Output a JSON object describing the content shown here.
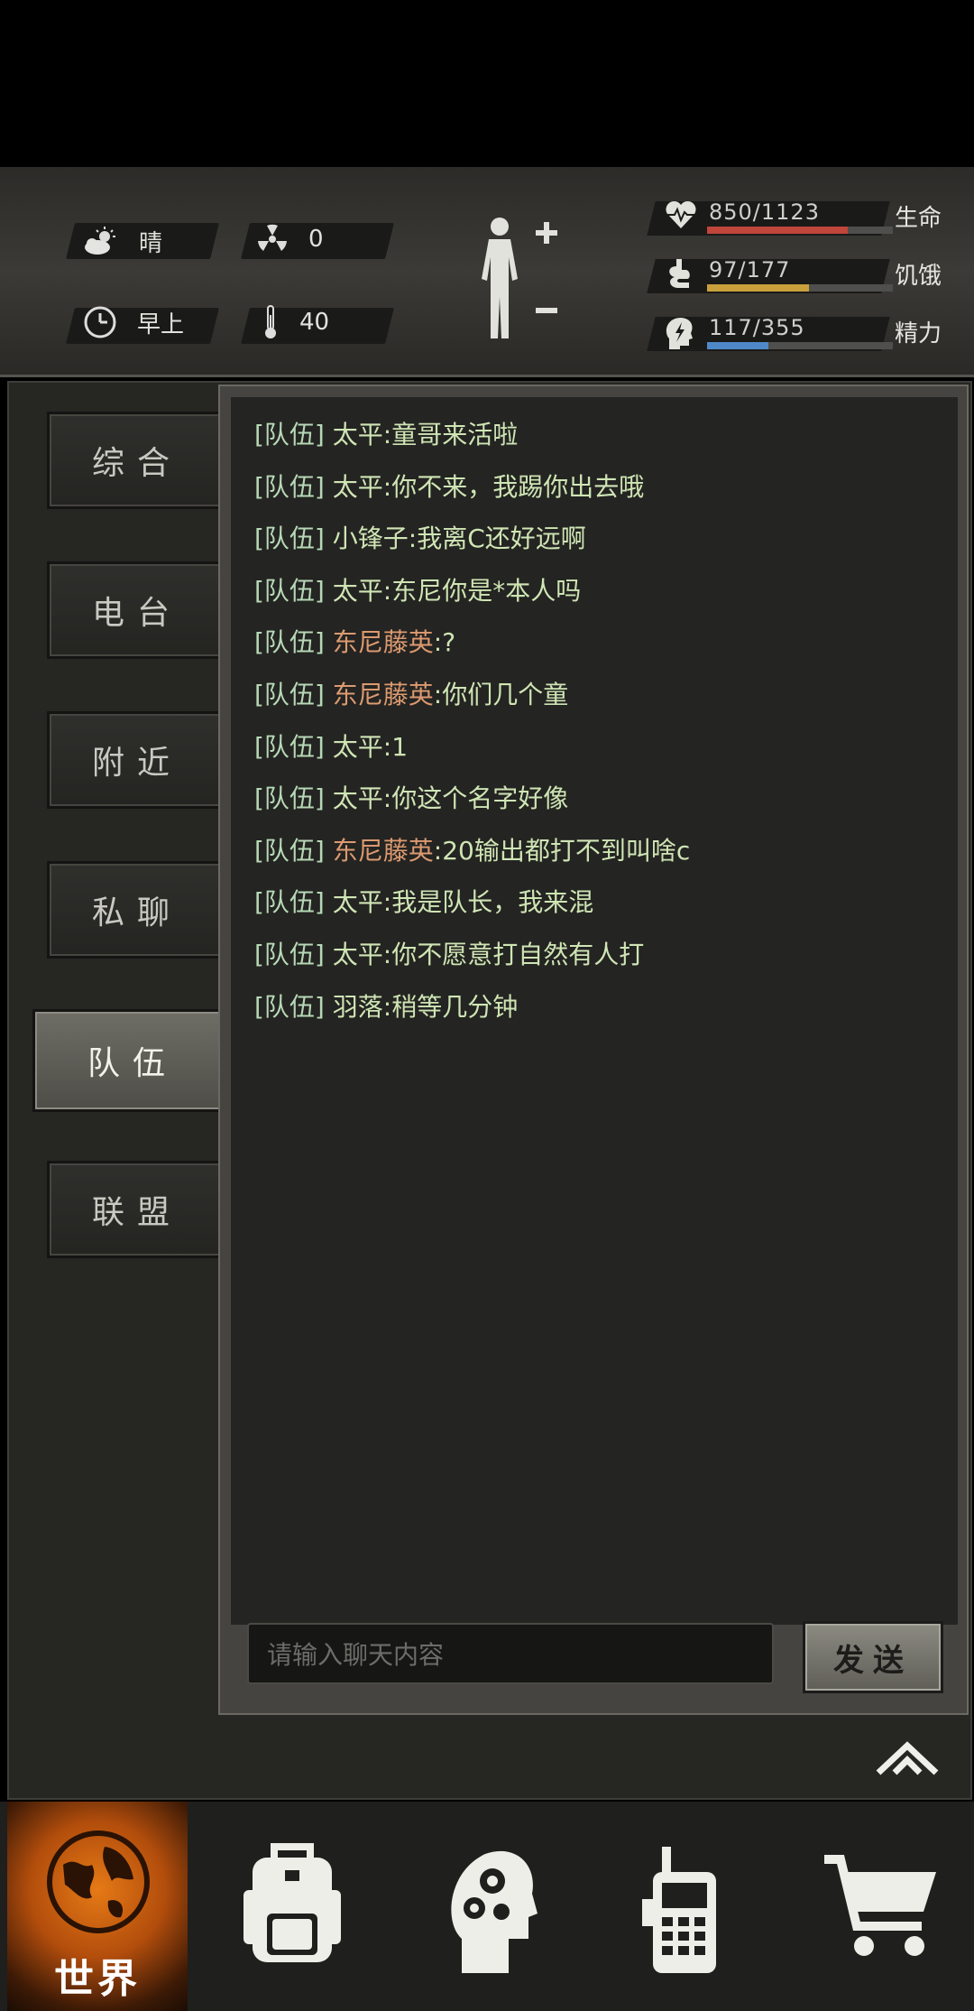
{
  "header": {
    "weather": "晴",
    "radiation": "0",
    "time_of_day": "早上",
    "temperature": "40",
    "stats": [
      {
        "value": "850/1123",
        "label": "生命",
        "fill": 0.757,
        "color": "#c0453a"
      },
      {
        "value": "97/177",
        "label": "饥饿",
        "fill": 0.548,
        "color": "#c9a03c"
      },
      {
        "value": "117/355",
        "label": "精力",
        "fill": 0.33,
        "color": "#4f88c8"
      }
    ]
  },
  "tabs": [
    "综合",
    "电台",
    "附近",
    "私聊",
    "队伍",
    "联盟"
  ],
  "active_tab": "队伍",
  "messages": [
    {
      "channel": "[队伍]",
      "name": "太平",
      "text": "童哥来活啦",
      "name_color": "green"
    },
    {
      "channel": "[队伍]",
      "name": "太平",
      "text": "你不来，我踢你出去哦",
      "name_color": "green"
    },
    {
      "channel": "[队伍]",
      "name": "小锋子",
      "text": "我离C还好远啊",
      "name_color": "green"
    },
    {
      "channel": "[队伍]",
      "name": "太平",
      "text": "东尼你是*本人吗",
      "name_color": "green"
    },
    {
      "channel": "[队伍]",
      "name": "东尼藤英",
      "text": "?",
      "name_color": "orange"
    },
    {
      "channel": "[队伍]",
      "name": "东尼藤英",
      "text": "你们几个童",
      "name_color": "orange"
    },
    {
      "channel": "[队伍]",
      "name": "太平",
      "text": "1",
      "name_color": "green"
    },
    {
      "channel": "[队伍]",
      "name": "太平",
      "text": "你这个名字好像",
      "name_color": "green"
    },
    {
      "channel": "[队伍]",
      "name": "东尼藤英",
      "text": "20输出都打不到叫啥c",
      "name_color": "orange"
    },
    {
      "channel": "[队伍]",
      "name": "太平",
      "text": "我是队长，我来混",
      "name_color": "green"
    },
    {
      "channel": "[队伍]",
      "name": "太平",
      "text": "你不愿意打自然有人打",
      "name_color": "green"
    },
    {
      "channel": "[队伍]",
      "name": "羽落",
      "text": "稍等几分钟",
      "name_color": "green"
    }
  ],
  "chat_input": {
    "placeholder": "请输入聊天内容"
  },
  "send_label": "发送",
  "nav": {
    "world_label": "世界",
    "items": [
      "backpack-icon",
      "skills-head-icon",
      "radio-icon",
      "shop-cart-icon"
    ]
  }
}
